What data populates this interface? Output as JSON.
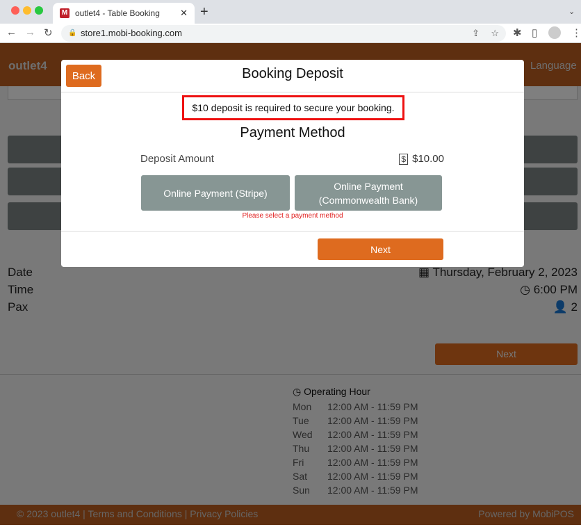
{
  "browser": {
    "tab_title": "outlet4 - Table Booking",
    "favicon_letter": "M",
    "url": "store1.mobi-booking.com"
  },
  "site": {
    "brand": "outlet4",
    "language": "Language"
  },
  "booking": {
    "rows": [
      {
        "label": "Date",
        "value": "Thursday, February 2, 2023",
        "icon": "calendar-icon"
      },
      {
        "label": "Time",
        "value": "6:00 PM",
        "icon": "clock-icon"
      },
      {
        "label": "Pax",
        "value": "2",
        "icon": "user-icon"
      }
    ],
    "next": "Next"
  },
  "hours": {
    "title": "Operating Hour",
    "days": [
      {
        "day": "Mon",
        "time": "12:00 AM - 11:59 PM"
      },
      {
        "day": "Tue",
        "time": "12:00 AM - 11:59 PM"
      },
      {
        "day": "Wed",
        "time": "12:00 AM - 11:59 PM"
      },
      {
        "day": "Thu",
        "time": "12:00 AM - 11:59 PM"
      },
      {
        "day": "Fri",
        "time": "12:00 AM - 11:59 PM"
      },
      {
        "day": "Sat",
        "time": "12:00 AM - 11:59 PM"
      },
      {
        "day": "Sun",
        "time": "12:00 AM - 11:59 PM"
      }
    ]
  },
  "footer": {
    "copyright": "© 2023 outlet4 |",
    "terms": "Terms and Conditions",
    "sep": "|",
    "privacy": "Privacy Policies",
    "powered": "Powered by MobiPOS"
  },
  "modal": {
    "back": "Back",
    "title": "Booking Deposit",
    "notice": "$10 deposit is required to secure your booking.",
    "payment_title": "Payment Method",
    "deposit_label": "Deposit Amount",
    "deposit_amount": "$10.00",
    "stripe": "Online Payment (Stripe)",
    "cba_line1": "Online Payment",
    "cba_line2": "(Commonwealth Bank)",
    "error": "Please select a payment method",
    "next": "Next"
  },
  "colors": {
    "accent": "#de6b1f",
    "error": "#e12020",
    "payment_button": "#879694",
    "notice_border": "#ee1111"
  }
}
